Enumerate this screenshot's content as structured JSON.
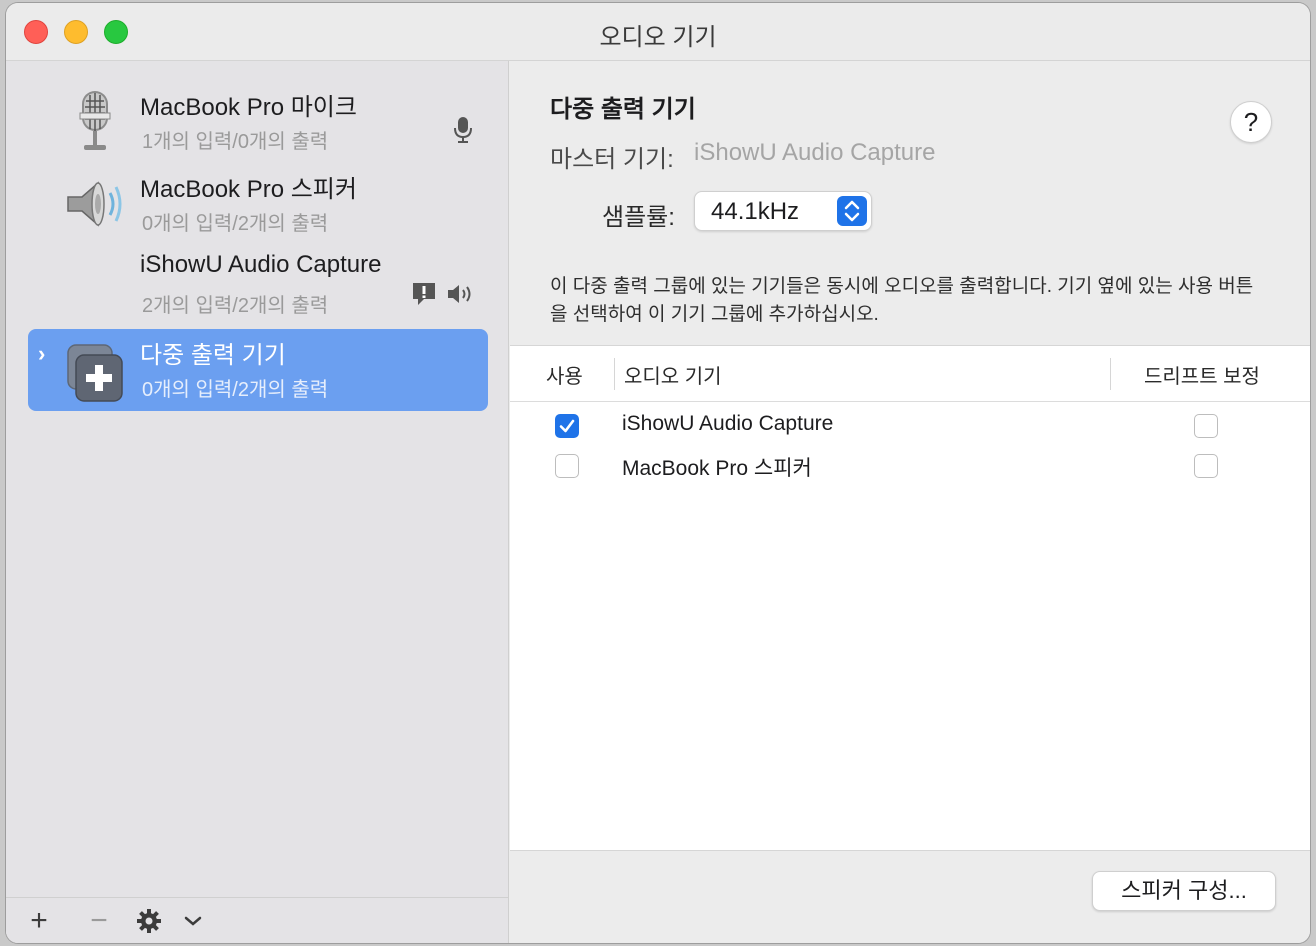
{
  "window": {
    "title": "오디오 기기"
  },
  "sidebar": {
    "devices": [
      {
        "name": "MacBook Pro 마이크",
        "io": "1개의 입력/0개의 출력",
        "icon": "microphone-icon",
        "status_icon": "microphone-small-icon"
      },
      {
        "name": "MacBook Pro 스피커",
        "io": "0개의 입력/2개의 출력",
        "icon": "speaker-icon"
      },
      {
        "name": "iShowU Audio Capture",
        "io": "2개의 입력/2개의 출력",
        "status_icons": [
          "alert-bubble-icon",
          "speaker-small-icon"
        ]
      },
      {
        "name": "다중 출력 기기",
        "io": "0개의 입력/2개의 출력",
        "icon": "multi-output-device-icon",
        "selected": true
      }
    ],
    "footer": {
      "add": "+",
      "remove": "−",
      "settings_icon": "gear-icon",
      "menu_icon": "chevron-down-icon"
    }
  },
  "main": {
    "title": "다중 출력 기기",
    "help": "?",
    "master_label": "마스터 기기:",
    "master_value": "iShowU Audio Capture",
    "sample_rate_label": "샘플률:",
    "sample_rate_value": "44.1kHz",
    "description": "이 다중 출력 그룹에 있는 기기들은 동시에 오디오를 출력합니다. 기기 옆에 있는 사용 버튼을 선택하여 이 기기 그룹에 추가하십시오.",
    "table": {
      "headers": {
        "use": "사용",
        "device": "오디오 기기",
        "drift": "드리프트 보정"
      },
      "rows": [
        {
          "use": true,
          "device": "iShowU Audio Capture",
          "drift": false
        },
        {
          "use": false,
          "device": "MacBook Pro 스피커",
          "drift": false
        }
      ]
    },
    "configure_speakers": "스피커 구성..."
  },
  "colors": {
    "accent": "#1f73e8",
    "selection": "#6b9ff0"
  }
}
